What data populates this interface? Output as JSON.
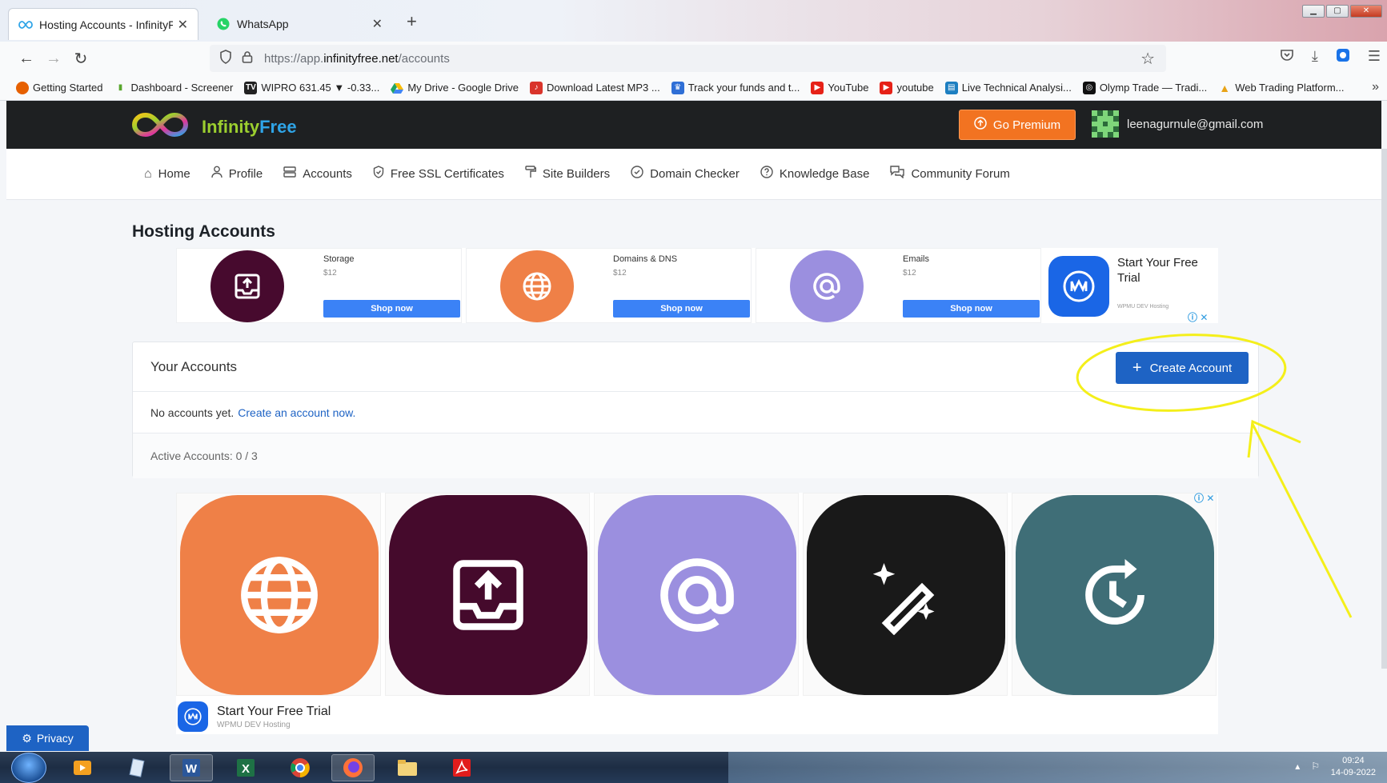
{
  "browser": {
    "tabs": [
      {
        "label": "Hosting Accounts - InfinityFree",
        "active": true
      },
      {
        "label": "WhatsApp",
        "active": false
      }
    ],
    "url_prefix": "https://app.",
    "url_domain": "infinityfree.net",
    "url_path": "/accounts",
    "bookmarks": [
      {
        "label": "Getting Started",
        "icon": "firefox-icon",
        "color": "#e66000"
      },
      {
        "label": "Dashboard - Screener",
        "icon": "bar-chart-icon",
        "color": "#58a62c"
      },
      {
        "label": "WIPRO 631.45 ▼ -0.33...",
        "icon": "tv-icon",
        "color": "#222222"
      },
      {
        "label": "My Drive - Google Drive",
        "icon": "drive-icon",
        "color": "#1fa463"
      },
      {
        "label": "Download Latest MP3 ...",
        "icon": "music-icon",
        "color": "#d9342b"
      },
      {
        "label": "Track your funds and t...",
        "icon": "crown-icon",
        "color": "#2f6fd6"
      },
      {
        "label": "YouTube",
        "icon": "youtube-icon",
        "color": "#e62117"
      },
      {
        "label": "youtube",
        "icon": "youtube-icon",
        "color": "#e62117"
      },
      {
        "label": "Live Technical Analysi...",
        "icon": "chart-icon",
        "color": "#1d7fc1"
      },
      {
        "label": "Olymp Trade — Tradi...",
        "icon": "olymp-icon",
        "color": "#111111"
      },
      {
        "label": "Web Trading Platform...",
        "icon": "triangle-icon",
        "color": "#e8a317"
      }
    ]
  },
  "site": {
    "logo_part1": "Infinity",
    "logo_part2": "Free",
    "premium_label": "Go Premium",
    "user_email": "leenagurnule@gmail.com",
    "nav": [
      {
        "label": "Home",
        "icon": "home-icon"
      },
      {
        "label": "Profile",
        "icon": "user-icon"
      },
      {
        "label": "Accounts",
        "icon": "server-icon"
      },
      {
        "label": "Free SSL Certificates",
        "icon": "shield-icon"
      },
      {
        "label": "Site Builders",
        "icon": "paint-roller-icon"
      },
      {
        "label": "Domain Checker",
        "icon": "check-circle-icon"
      },
      {
        "label": "Knowledge Base",
        "icon": "question-circle-icon"
      },
      {
        "label": "Community Forum",
        "icon": "comments-icon"
      }
    ]
  },
  "page": {
    "title": "Hosting Accounts"
  },
  "top_ad": {
    "cards": [
      {
        "title": "Storage",
        "price": "$12",
        "button": "Shop now",
        "color": "#470a2e",
        "icon": "upload-tray-icon"
      },
      {
        "title": "Domains & DNS",
        "price": "$12",
        "button": "Shop now",
        "color": "#ef8047",
        "icon": "globe-icon"
      },
      {
        "title": "Emails",
        "price": "$12",
        "button": "Shop now",
        "color": "#9b8fdf",
        "icon": "at-sign-icon"
      }
    ],
    "trial_title": "Start Your Free Trial",
    "trial_sub": "WPMU DEV Hosting"
  },
  "accounts_card": {
    "heading": "Your Accounts",
    "create_label": "Create Account",
    "empty_text": "No accounts yet.",
    "empty_link": "Create an account now.",
    "active_label": "Active Accounts: 0 / 3"
  },
  "big_ad": {
    "tiles": [
      {
        "color": "#ef8047",
        "icon": "globe-icon"
      },
      {
        "color": "#450a2c",
        "icon": "upload-tray-icon"
      },
      {
        "color": "#9b8fdf",
        "icon": "at-sign-icon"
      },
      {
        "color": "#191919",
        "icon": "magic-wand-icon"
      },
      {
        "color": "#3f6e77",
        "icon": "history-icon"
      }
    ],
    "footer_title": "Start Your Free Trial",
    "footer_sub": "WPMU DEV Hosting"
  },
  "privacy_label": "Privacy",
  "taskbar": {
    "time": "09:24",
    "date": "14-09-2022"
  },
  "colors": {
    "header_bg": "#1e2022",
    "primary": "#1e63c4",
    "premium": "#f27321",
    "annotation": "#f4ef1a"
  }
}
